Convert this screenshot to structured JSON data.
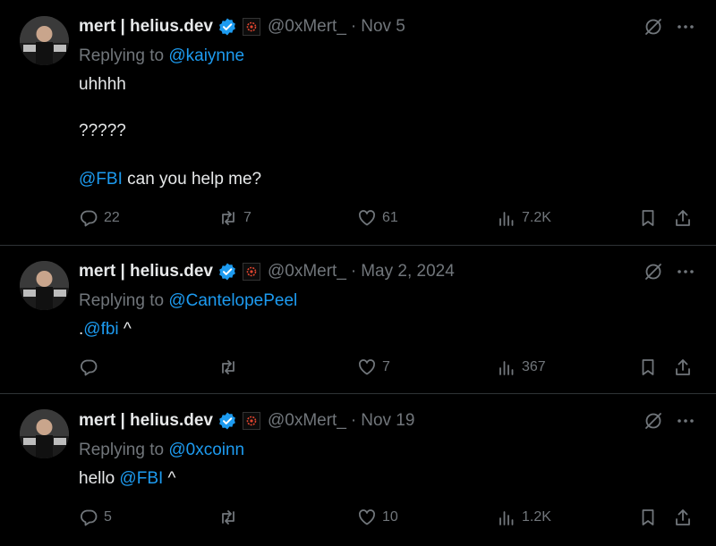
{
  "colors": {
    "background": "#000000",
    "text": "#e7e9ea",
    "muted": "#71767b",
    "link": "#1d9bf0",
    "verified": "#1d9bf0",
    "divider": "#2f3336"
  },
  "icons": [
    "verified-badge-icon",
    "affiliate-badge-icon",
    "grok-icon",
    "more-icon",
    "reply-icon",
    "retweet-icon",
    "like-icon",
    "views-icon",
    "bookmark-icon",
    "share-icon"
  ],
  "tweets": [
    {
      "name": "mert | helius.dev",
      "handle": "@0xMert_",
      "separator": "·",
      "date": "Nov 5",
      "replying_prefix": "Replying to",
      "replying_to": "@kaiynne",
      "line1_text": "uhhhh",
      "line2_text": "?????",
      "line3_mention": "@FBI",
      "line3_text": " can you help me?",
      "replies": "22",
      "retweets": "7",
      "likes": "61",
      "views": "7.2K"
    },
    {
      "name": "mert | helius.dev",
      "handle": "@0xMert_",
      "separator": "·",
      "date": "May 2, 2024",
      "replying_prefix": "Replying to",
      "replying_to": "@CantelopePeel",
      "line1_pre": ".",
      "line1_mention": "@fbi",
      "line1_post": " ^",
      "replies": "",
      "retweets": "",
      "likes": "7",
      "views": "367"
    },
    {
      "name": "mert | helius.dev",
      "handle": "@0xMert_",
      "separator": "·",
      "date": "Nov 19",
      "replying_prefix": "Replying to",
      "replying_to": "@0xcoinn",
      "line1_pre": "hello ",
      "line1_mention": "@FBI",
      "line1_post": " ^",
      "replies": "5",
      "retweets": "",
      "likes": "10",
      "views": "1.2K"
    }
  ]
}
